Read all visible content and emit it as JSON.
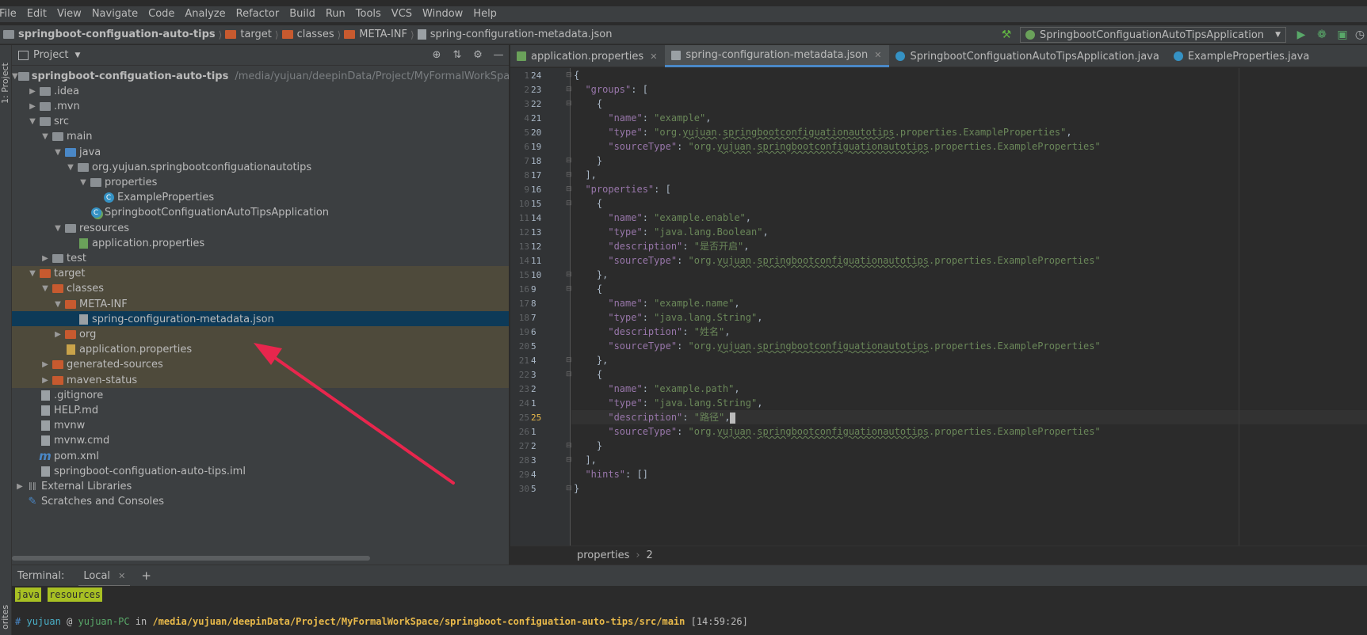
{
  "menu": [
    "File",
    "Edit",
    "View",
    "Navigate",
    "Code",
    "Analyze",
    "Refactor",
    "Build",
    "Run",
    "Tools",
    "VCS",
    "Window",
    "Help"
  ],
  "navbar": {
    "crumbs": [
      "springboot-configuation-auto-tips",
      "target",
      "classes",
      "META-INF",
      "spring-configuration-metadata.json"
    ],
    "run_config": "SpringbootConfiguationAutoTipsApplication"
  },
  "sidebar": {
    "project_tab": "1: Project",
    "favorites_tab": "orites"
  },
  "project": {
    "title": "Project",
    "root_path": "/media/yujuan/deepinData/Project/MyFormalWorkSpace",
    "tree": [
      {
        "label": "springboot-configuation-auto-tips",
        "depth": 0,
        "arrow": "down",
        "icon": "module-folder",
        "bold": true
      },
      {
        "label": ".idea",
        "depth": 1,
        "arrow": "right",
        "icon": "folder-grey"
      },
      {
        "label": ".mvn",
        "depth": 1,
        "arrow": "right",
        "icon": "folder-grey"
      },
      {
        "label": "src",
        "depth": 1,
        "arrow": "down",
        "icon": "folder-grey"
      },
      {
        "label": "main",
        "depth": 2,
        "arrow": "down",
        "icon": "folder-grey"
      },
      {
        "label": "java",
        "depth": 3,
        "arrow": "down",
        "icon": "folder-blue"
      },
      {
        "label": "org.yujuan.springbootconfiguationautotips",
        "depth": 4,
        "arrow": "down",
        "icon": "package"
      },
      {
        "label": "properties",
        "depth": 5,
        "arrow": "down",
        "icon": "package"
      },
      {
        "label": "ExampleProperties",
        "depth": 6,
        "arrow": "",
        "icon": "class"
      },
      {
        "label": "SpringbootConfiguationAutoTipsApplication",
        "depth": 5,
        "arrow": "",
        "icon": "spring-class"
      },
      {
        "label": "resources",
        "depth": 3,
        "arrow": "down",
        "icon": "folder-res"
      },
      {
        "label": "application.properties",
        "depth": 4,
        "arrow": "",
        "icon": "spring-props"
      },
      {
        "label": "test",
        "depth": 2,
        "arrow": "right",
        "icon": "folder-grey"
      },
      {
        "label": "target",
        "depth": 1,
        "arrow": "down",
        "icon": "folder-orange",
        "hl": true
      },
      {
        "label": "classes",
        "depth": 2,
        "arrow": "down",
        "icon": "folder-orange",
        "hl": true
      },
      {
        "label": "META-INF",
        "depth": 3,
        "arrow": "down",
        "icon": "folder-orange",
        "hl": true
      },
      {
        "label": "spring-configuration-metadata.json",
        "depth": 4,
        "arrow": "",
        "icon": "json",
        "sel": true
      },
      {
        "label": "org",
        "depth": 3,
        "arrow": "right",
        "icon": "folder-orange",
        "hl": true
      },
      {
        "label": "application.properties",
        "depth": 3,
        "arrow": "",
        "icon": "props",
        "hl": true
      },
      {
        "label": "generated-sources",
        "depth": 2,
        "arrow": "right",
        "icon": "folder-orange",
        "hl": true
      },
      {
        "label": "maven-status",
        "depth": 2,
        "arrow": "right",
        "icon": "folder-orange",
        "hl": true
      },
      {
        "label": ".gitignore",
        "depth": 1,
        "arrow": "",
        "icon": "file"
      },
      {
        "label": "HELP.md",
        "depth": 1,
        "arrow": "",
        "icon": "md"
      },
      {
        "label": "mvnw",
        "depth": 1,
        "arrow": "",
        "icon": "shell"
      },
      {
        "label": "mvnw.cmd",
        "depth": 1,
        "arrow": "",
        "icon": "file"
      },
      {
        "label": "pom.xml",
        "depth": 1,
        "arrow": "",
        "icon": "maven"
      },
      {
        "label": "springboot-configuation-auto-tips.iml",
        "depth": 1,
        "arrow": "",
        "icon": "file"
      },
      {
        "label": "External Libraries",
        "depth": 0,
        "arrow": "right",
        "icon": "libs"
      },
      {
        "label": "Scratches and Consoles",
        "depth": 0,
        "arrow": "",
        "icon": "scratch"
      }
    ]
  },
  "editor": {
    "tabs": [
      {
        "label": "application.properties",
        "active": false
      },
      {
        "label": "spring-configuration-metadata.json",
        "active": true
      },
      {
        "label": "SpringbootConfiguationAutoTipsApplication.java",
        "active": false
      },
      {
        "label": "ExampleProperties.java",
        "active": false
      }
    ],
    "relative_numbers": [
      "24",
      "23",
      "22",
      "21",
      "20",
      "19",
      "18",
      "17",
      "16",
      "15",
      "14",
      "13",
      "12",
      "11",
      "10",
      "9",
      "8",
      "7",
      "6",
      "5",
      "4",
      "3",
      "2",
      "1",
      "25",
      "1",
      "2",
      "3",
      "4",
      "5"
    ],
    "lines": [
      "{",
      "  \"groups\": [",
      "    {",
      "      \"name\": \"example\",",
      "      \"type\": \"org.yujuan.springbootconfiguationautotips.properties.ExampleProperties\",",
      "      \"sourceType\": \"org.yujuan.springbootconfiguationautotips.properties.ExampleProperties\"",
      "    }",
      "  ],",
      "  \"properties\": [",
      "    {",
      "      \"name\": \"example.enable\",",
      "      \"type\": \"java.lang.Boolean\",",
      "      \"description\": \"是否开启\",",
      "      \"sourceType\": \"org.yujuan.springbootconfiguationautotips.properties.ExampleProperties\"",
      "    },",
      "    {",
      "      \"name\": \"example.name\",",
      "      \"type\": \"java.lang.String\",",
      "      \"description\": \"姓名\",",
      "      \"sourceType\": \"org.yujuan.springbootconfiguationautotips.properties.ExampleProperties\"",
      "    },",
      "    {",
      "      \"name\": \"example.path\",",
      "      \"type\": \"java.lang.String\",",
      "      \"description\": \"路径\",",
      "      \"sourceType\": \"org.yujuan.springbootconfiguationautotips.properties.ExampleProperties\"",
      "    }",
      "  ],",
      "  \"hints\": []",
      "}"
    ],
    "breadcrumb": [
      "properties",
      "2"
    ]
  },
  "terminal": {
    "label": "Terminal:",
    "tab": "Local",
    "tags": [
      "java",
      "resources"
    ],
    "prompt_hash": "#",
    "user": "yujuan",
    "at": "@",
    "host": "yujuan-PC",
    "in": "in",
    "path": "/media/yujuan/deepinData/Project/MyFormalWorkSpace/springboot-configuation-auto-tips/src/main",
    "time": "[14:59:26]"
  },
  "colors": {
    "accent": "#4a88c7",
    "string": "#6a8759",
    "key": "#9876aa",
    "arrow": "#e8264d",
    "target_hl": "#4e4a3b",
    "selection": "#0d3a58"
  }
}
